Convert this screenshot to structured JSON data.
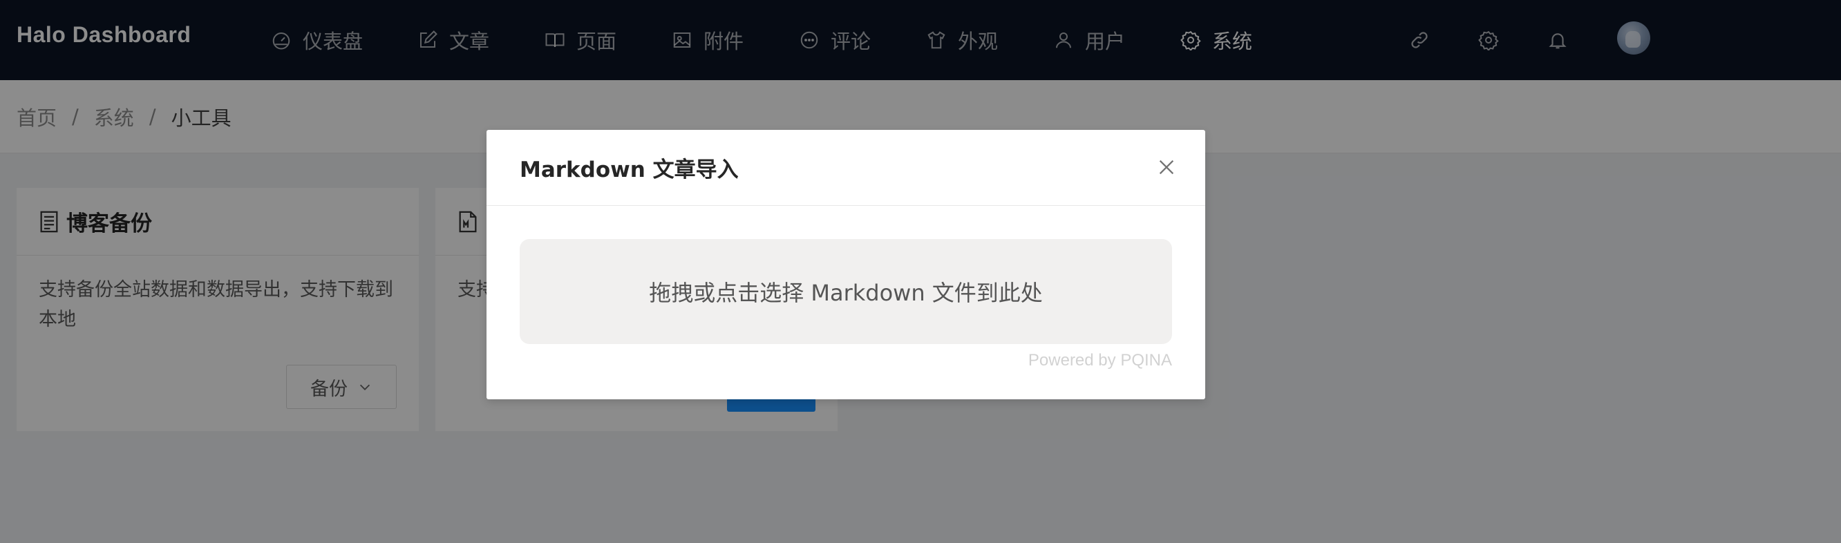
{
  "app": {
    "title": "Halo  Dashboard"
  },
  "nav": {
    "items": [
      {
        "label": "仪表盘",
        "icon": "dashboard-icon"
      },
      {
        "label": "文章",
        "icon": "edit-icon"
      },
      {
        "label": "页面",
        "icon": "read-icon"
      },
      {
        "label": "附件",
        "icon": "picture-icon"
      },
      {
        "label": "评论",
        "icon": "message-icon"
      },
      {
        "label": "外观",
        "icon": "skin-icon"
      },
      {
        "label": "用户",
        "icon": "user-icon"
      },
      {
        "label": "系统",
        "icon": "setting-icon",
        "active": true
      }
    ],
    "right_icons": [
      "link-icon",
      "setting-icon",
      "bell-icon",
      "avatar"
    ]
  },
  "breadcrumb": {
    "items": [
      "首页",
      "系统",
      "小工具"
    ]
  },
  "cards": [
    {
      "title": "博客备份",
      "icon": "file-text-icon",
      "description": "支持备份全站数据和数据导出，支持下载到本地",
      "button_label": "备份"
    },
    {
      "title": "",
      "icon": "file-markdown-icon",
      "description": "支持",
      "button_label": ""
    }
  ],
  "modal": {
    "title": "Markdown 文章导入",
    "dropzone_text": "拖拽或点击选择 Markdown 文件到此处",
    "credits": "Powered by PQINA"
  },
  "colors": {
    "topbar_bg": "#0b1526",
    "primary": "#1890ff",
    "mask": "rgba(0,0,0,0.45)",
    "dropzone_bg": "#f1f0ef"
  }
}
